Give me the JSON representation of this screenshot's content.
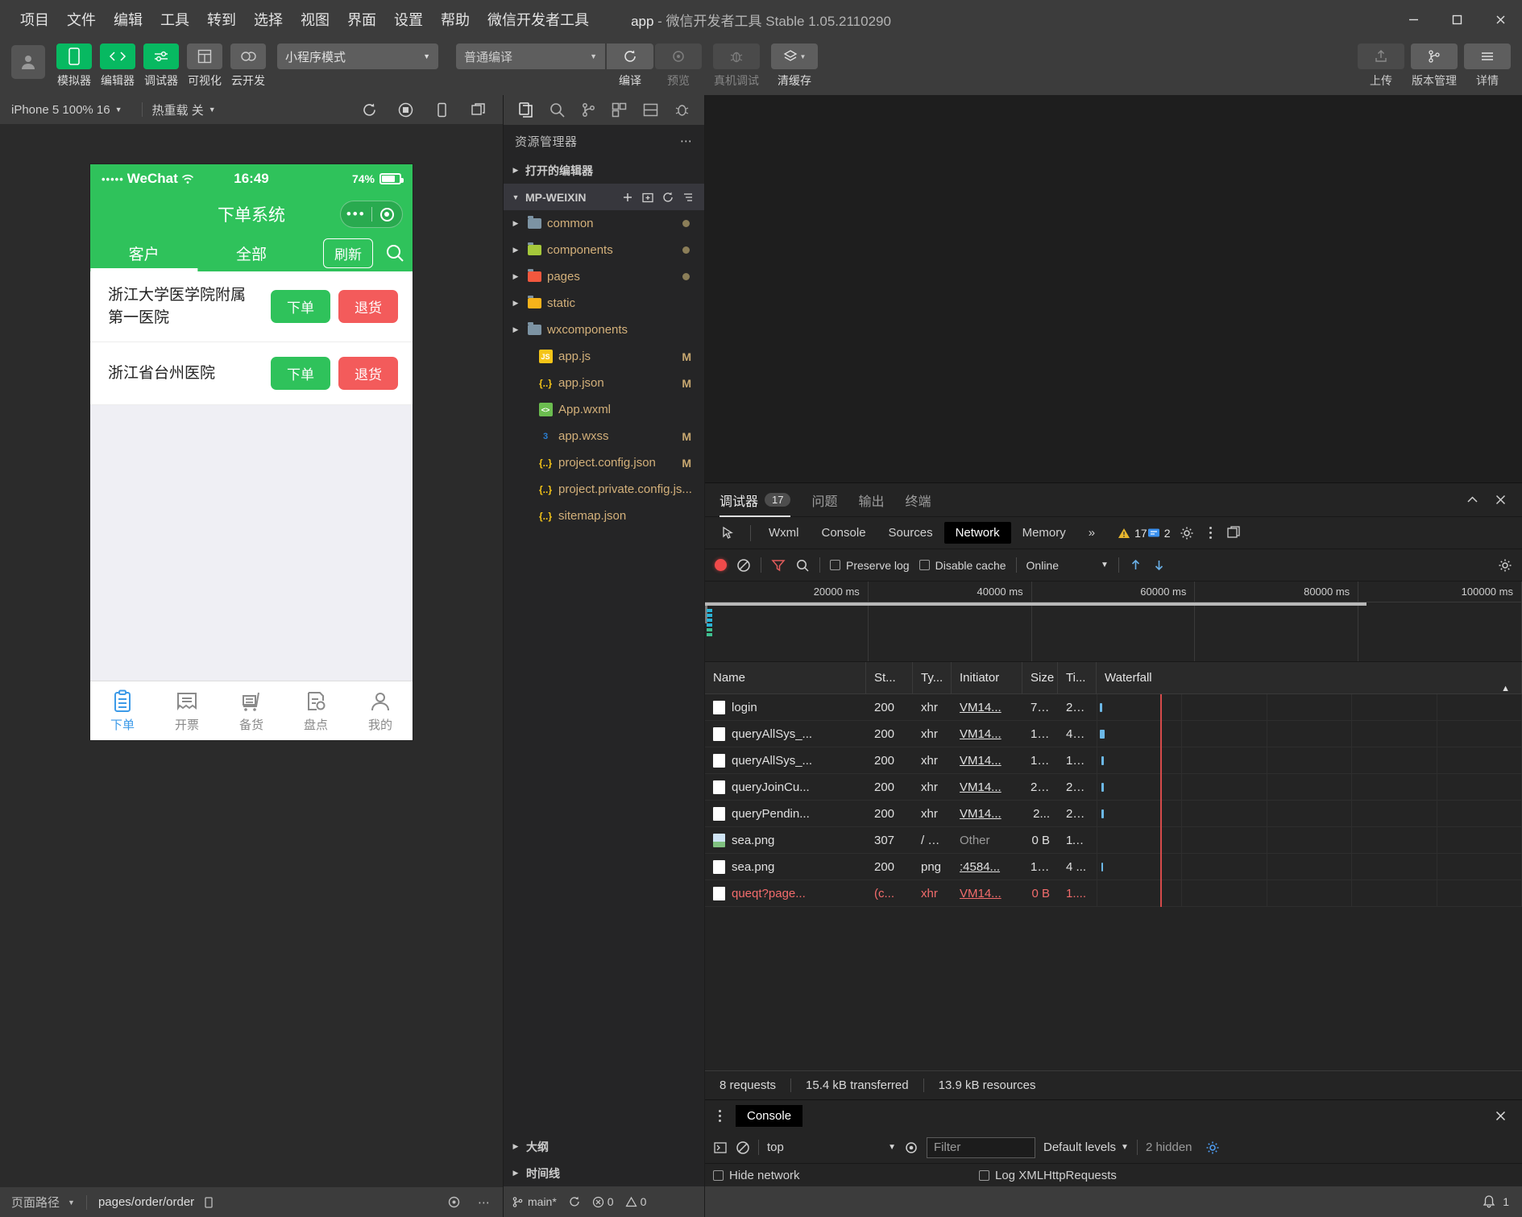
{
  "window": {
    "title_app": "app",
    "title_rest": "- 微信开发者工具 Stable 1.05.2110290",
    "minimize": "—",
    "maximize": "▢",
    "close": "✕"
  },
  "menu": [
    "项目",
    "文件",
    "编辑",
    "工具",
    "转到",
    "选择",
    "视图",
    "界面",
    "设置",
    "帮助",
    "微信开发者工具"
  ],
  "toolbar": {
    "mode_select": "小程序模式",
    "buttons": [
      {
        "label": "模拟器",
        "icon": "phone-icon",
        "style": "green"
      },
      {
        "label": "编辑器",
        "icon": "code-icon",
        "style": "green"
      },
      {
        "label": "调试器",
        "icon": "debugger-icon",
        "style": "green"
      },
      {
        "label": "可视化",
        "icon": "layout-icon",
        "style": "grey"
      },
      {
        "label": "云开发",
        "icon": "cloud-icon",
        "style": "grey"
      }
    ],
    "compile_select": "普通编译",
    "actions": [
      {
        "label": "编译",
        "icon": "refresh-icon",
        "dim": false
      },
      {
        "label": "预览",
        "icon": "eye-icon",
        "dim": true
      },
      {
        "label": "真机调试",
        "icon": "bug-icon",
        "dim": true
      },
      {
        "label": "清缓存",
        "icon": "layers-icon",
        "dim": false
      }
    ],
    "right": [
      {
        "label": "上传",
        "icon": "upload-icon",
        "dim": true
      },
      {
        "label": "版本管理",
        "icon": "branch-icon",
        "dim": false
      },
      {
        "label": "详情",
        "icon": "menu-icon",
        "dim": false
      }
    ]
  },
  "simulator": {
    "device_select": "iPhone 5 100% 16",
    "hotreload_select": "热重载 关",
    "icons": [
      "refresh-icon",
      "stop-icon",
      "phone-icon",
      "windows-icon"
    ],
    "phone": {
      "status": {
        "carrier": "WeChat",
        "dots": "•••••",
        "time": "16:49",
        "battery_pct": "74%"
      },
      "nav_title": "下单系统",
      "capsule": {
        "more": "•••",
        "target": "target-icon"
      },
      "tabs": [
        {
          "label": "客户",
          "active": true
        },
        {
          "label": "全部",
          "active": false
        }
      ],
      "refresh_button": "刷新",
      "search_icon": "search-icon",
      "rows": [
        {
          "name": "浙江大学医学院附属第一医院",
          "order": "下单",
          "ret": "退货"
        },
        {
          "name": "浙江省台州医院",
          "order": "下单",
          "ret": "退货"
        }
      ],
      "tabbar": [
        {
          "label": "下单",
          "icon": "clipboard-icon",
          "active": true
        },
        {
          "label": "开票",
          "icon": "receipt-icon",
          "active": false
        },
        {
          "label": "备货",
          "icon": "cart-icon",
          "active": false
        },
        {
          "label": "盘点",
          "icon": "inventory-icon",
          "active": false
        },
        {
          "label": "我的",
          "icon": "person-icon",
          "active": false
        }
      ]
    },
    "footer": {
      "path_label": "页面路径",
      "path_value": "pages/order/order",
      "copy_icon": "copy-icon",
      "eye_icon": "eye-icon",
      "more_icon": "more-icon"
    }
  },
  "explorer": {
    "activity_icons": [
      "files-icon",
      "search-icon",
      "branch-icon",
      "extensions-icon",
      "split-icon",
      "bug-icon"
    ],
    "title": "资源管理器",
    "more": "⋯",
    "sections": [
      {
        "label": "打开的编辑器",
        "expanded": false
      },
      {
        "label": "MP-WEIXIN",
        "expanded": true,
        "actions": [
          "new-file-icon",
          "new-folder-icon",
          "refresh-icon",
          "collapse-icon"
        ]
      }
    ],
    "files": [
      {
        "name": "common",
        "type": "folder",
        "color": "#7c93a3",
        "badge": "",
        "dot": true
      },
      {
        "name": "components",
        "type": "folder",
        "color": "#a5c83b",
        "badge": "",
        "dot": true
      },
      {
        "name": "pages",
        "type": "folder",
        "color": "#f2583e",
        "badge": "",
        "dot": true
      },
      {
        "name": "static",
        "type": "folder",
        "color": "#f5b21b",
        "badge": "",
        "dot": false
      },
      {
        "name": "wxcomponents",
        "type": "folder",
        "color": "#7c93a3",
        "badge": "",
        "dot": false
      },
      {
        "name": "app.js",
        "type": "js",
        "color": "#f5c518",
        "glyph": "JS",
        "badge": "M",
        "dot": false
      },
      {
        "name": "app.json",
        "type": "json",
        "color": "#f5c518",
        "glyph": "{..}",
        "badge": "M",
        "dot": false
      },
      {
        "name": "App.wxml",
        "type": "wxml",
        "color": "#6bbd4f",
        "glyph": "<>",
        "badge": "",
        "dot": false
      },
      {
        "name": "app.wxss",
        "type": "wxss",
        "color": "#2a7fd4",
        "glyph": "3",
        "badge": "M",
        "dot": false
      },
      {
        "name": "project.config.json",
        "type": "json",
        "color": "#f5c518",
        "glyph": "{..}",
        "badge": "M",
        "dot": false
      },
      {
        "name": "project.private.config.js...",
        "type": "json",
        "color": "#f5c518",
        "glyph": "{..}",
        "badge": "",
        "dot": false
      },
      {
        "name": "sitemap.json",
        "type": "json",
        "color": "#f5c518",
        "glyph": "{..}",
        "badge": "",
        "dot": false
      }
    ],
    "bottom_sections": [
      {
        "label": "大纲"
      },
      {
        "label": "时间线"
      }
    ],
    "status": {
      "branch": "main*",
      "sync_icon": "sync-icon",
      "errors": "0",
      "warnings": "0"
    }
  },
  "devtools": {
    "top_tabs": [
      {
        "label": "调试器",
        "count": "17",
        "active": true
      },
      {
        "label": "问题",
        "count": "",
        "active": false
      },
      {
        "label": "输出",
        "count": "",
        "active": false
      },
      {
        "label": "终端",
        "count": "",
        "active": false
      }
    ],
    "top_right_icons": [
      "chevron-up-icon",
      "close-icon"
    ],
    "panel_tabs": [
      "Wxml",
      "Console",
      "Sources",
      "Network",
      "Memory"
    ],
    "panel_active": "Network",
    "panel_overflow": "»",
    "warnings_count": "17",
    "messages_count": "2",
    "panel_right_icons": [
      "gear-icon",
      "kebab-icon",
      "dock-icon"
    ],
    "network_toolbar": {
      "record_icon": "record-icon",
      "clear_icon": "clear-icon",
      "filter_icon": "filter-icon",
      "search_icon": "search-icon",
      "preserve_log": "Preserve log",
      "disable_cache": "Disable cache",
      "throttle": "Online",
      "import_icon": "import-icon",
      "export_icon": "export-icon",
      "settings_icon": "gear-icon"
    },
    "overview_ticks": [
      "20000 ms",
      "40000 ms",
      "60000 ms",
      "80000 ms",
      "100000 ms"
    ],
    "table": {
      "columns": [
        "Name",
        "St...",
        "Ty...",
        "Initiator",
        "Size",
        "Ti...",
        "Waterfall"
      ],
      "rows": [
        {
          "name": "login",
          "status": "200",
          "type": "xhr",
          "initiator": "VM14...",
          "size": "7....",
          "time": "20...",
          "error": false,
          "icon": "file-icon",
          "wf_left": 0.5,
          "wf_w": 0.6
        },
        {
          "name": "queryAllSys_...",
          "status": "200",
          "type": "xhr",
          "initiator": "VM14...",
          "size": "1....",
          "time": "48...",
          "error": false,
          "icon": "file-icon",
          "wf_left": 0.5,
          "wf_w": 1.2
        },
        {
          "name": "queryAllSys_...",
          "status": "200",
          "type": "xhr",
          "initiator": "VM14...",
          "size": "1....",
          "time": "12...",
          "error": false,
          "icon": "file-icon",
          "wf_left": 1.0,
          "wf_w": 0.5
        },
        {
          "name": "queryJoinCu...",
          "status": "200",
          "type": "xhr",
          "initiator": "VM14...",
          "size": "2....",
          "time": "20...",
          "error": false,
          "icon": "file-icon",
          "wf_left": 1.0,
          "wf_w": 0.6
        },
        {
          "name": "queryPendin...",
          "status": "200",
          "type": "xhr",
          "initiator": "VM14...",
          "size": "2...",
          "time": "23...",
          "error": false,
          "icon": "file-icon",
          "wf_left": 1.0,
          "wf_w": 0.6
        },
        {
          "name": "sea.png",
          "status": "307",
          "type": "/ R...",
          "initiator": "Other",
          "size": "0 B",
          "time": "11...",
          "error": false,
          "icon": "image-icon",
          "wf_left": 0,
          "wf_w": 0
        },
        {
          "name": "sea.png",
          "status": "200",
          "type": "png",
          "initiator": ":4584...",
          "size": "1....",
          "time": "4 ...",
          "error": false,
          "icon": "file-icon",
          "wf_left": 1.0,
          "wf_w": 0.4
        },
        {
          "name": "queqt?page...",
          "status": "(c...",
          "type": "xhr",
          "initiator": "VM14...",
          "size": "0 B",
          "time": "1....",
          "error": true,
          "icon": "file-icon",
          "wf_left": 0,
          "wf_w": 0
        }
      ]
    },
    "footer": {
      "requests": "8 requests",
      "transferred": "15.4 kB transferred",
      "resources": "13.9 kB resources"
    },
    "console": {
      "tab": "Console",
      "close": "✕",
      "exec_icon": "execute-icon",
      "clear_icon": "clear-icon",
      "context": "top",
      "eye_icon": "eye-icon",
      "filter_placeholder": "Filter",
      "levels": "Default levels",
      "hidden": "2 hidden",
      "settings_icon": "gear-icon",
      "opt_hide_network": "Hide network",
      "opt_log_xhr": "Log XMLHttpRequests"
    },
    "bell": {
      "icon": "bell-icon",
      "count": "1"
    }
  }
}
